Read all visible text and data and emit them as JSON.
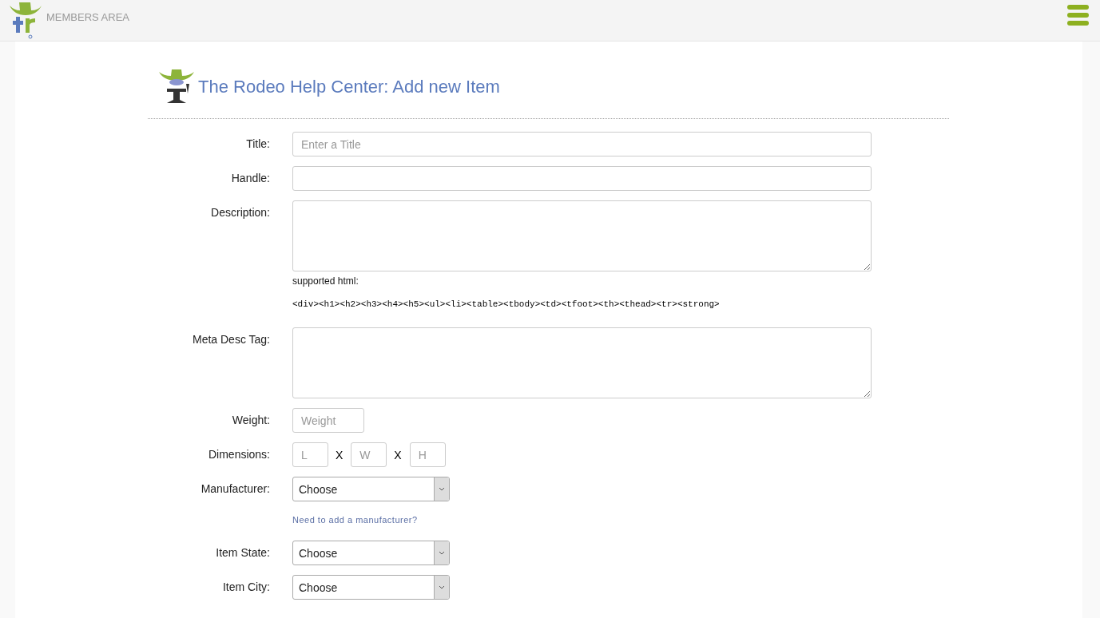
{
  "header": {
    "title": "MEMBERS AREA"
  },
  "page": {
    "heading": "The Rodeo Help Center: Add new Item"
  },
  "fields": [
    {
      "kind": "text",
      "label": "Title:",
      "placeholder": "Enter a Title"
    },
    {
      "kind": "text",
      "label": "Handle:"
    },
    {
      "kind": "textarea",
      "label": "Description:",
      "help": "supported html:",
      "code": "<div><h1><h2><h3><h4><h5><ul><li><table><tbody><td><tfoot><th><thead><tr><strong>"
    },
    {
      "kind": "textarea",
      "label": "Meta Desc Tag:"
    },
    {
      "kind": "number",
      "label": "Weight:",
      "placeholder": "Weight"
    },
    {
      "kind": "dimensions",
      "label": "Dimensions:",
      "parts": [
        {
          "placeholder": "L"
        },
        {
          "separator": "X",
          "placeholder": "W"
        },
        {
          "separator": "X",
          "placeholder": "H"
        }
      ]
    },
    {
      "kind": "select",
      "label": "Manufacturer:",
      "value": "Choose",
      "link": "Need to add a manufacturer?"
    },
    {
      "kind": "select",
      "label": "Item State:",
      "value": "Choose"
    },
    {
      "kind": "select",
      "label": "Item City:",
      "value": "Choose"
    }
  ]
}
